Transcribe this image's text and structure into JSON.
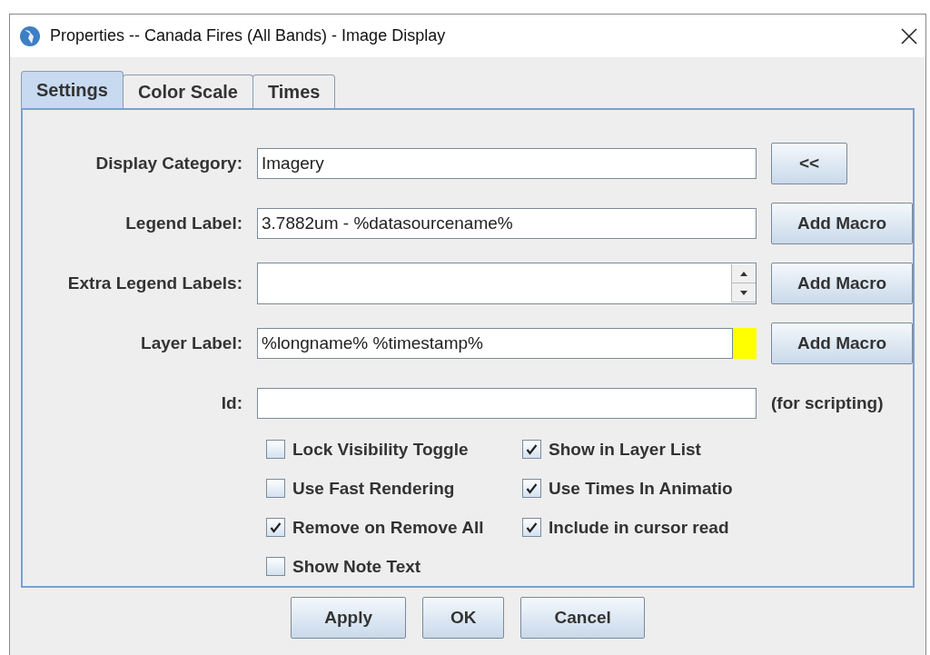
{
  "window": {
    "title": "Properties -- Canada Fires (All Bands) - Image Display"
  },
  "tabs": [
    {
      "label": "Settings",
      "selected": true
    },
    {
      "label": "Color Scale",
      "selected": false
    },
    {
      "label": "Times",
      "selected": false
    }
  ],
  "fields": [
    {
      "label": "Display Category:",
      "kind": "text",
      "value": "Imagery",
      "button": "<<"
    },
    {
      "label": "Legend Label:",
      "kind": "text",
      "value": "3.7882um - %datasourcename%",
      "button": "Add Macro"
    },
    {
      "label": "Extra Legend Labels:",
      "kind": "spinner",
      "button": "Add Macro"
    },
    {
      "label": "Layer Label:",
      "kind": "swatch",
      "value": "%longname% %timestamp%",
      "color": "#ffff00",
      "button": "Add Macro"
    },
    {
      "label": "Id:",
      "kind": "text",
      "note": "(for scripting)"
    }
  ],
  "checkboxes": [
    {
      "label": "Lock Visibility Toggle",
      "checked": false
    },
    {
      "label": "Show in Layer List",
      "checked": true
    },
    {
      "label": "Use Fast Rendering",
      "checked": false
    },
    {
      "label": "Use Times In Animatio",
      "checked": true
    },
    {
      "label": "Remove on Remove All",
      "checked": true
    },
    {
      "label": "Include in cursor read",
      "checked": true
    },
    {
      "label": "Show Note Text",
      "checked": false
    }
  ],
  "buttons": [
    "Apply",
    "OK",
    "Cancel"
  ]
}
